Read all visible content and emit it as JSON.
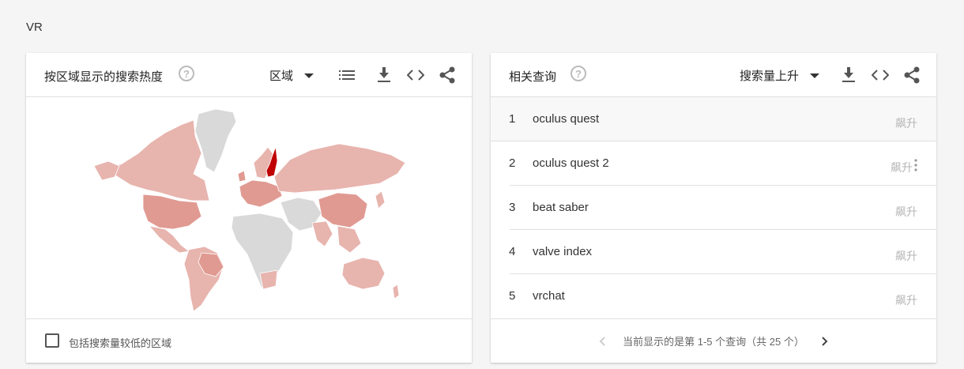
{
  "page": {
    "term": "VR"
  },
  "region_card": {
    "title": "按区域显示的搜索热度",
    "dropdown_label": "区域",
    "footer_checkbox_label": "包括搜索量较低的区域"
  },
  "related_card": {
    "title": "相关查询",
    "dropdown_label": "搜索量上升",
    "rows": [
      {
        "rank": "1",
        "query": "oculus quest",
        "value": "飙升"
      },
      {
        "rank": "2",
        "query": "oculus quest 2",
        "value": "飙升"
      },
      {
        "rank": "3",
        "query": "beat saber",
        "value": "飙升"
      },
      {
        "rank": "4",
        "query": "valve index",
        "value": "飙升"
      },
      {
        "rank": "5",
        "query": "vrchat",
        "value": "飙升"
      }
    ],
    "pager_text": "当前显示的是第 1-5 个查询（共 25 个）"
  },
  "icons": {
    "help": "help-circle-icon",
    "list": "list-icon",
    "download": "download-icon",
    "embed": "embed-code-icon",
    "share": "share-icon",
    "prev": "chevron-left-icon",
    "next": "chevron-right-icon"
  },
  "colors": {
    "map_low": "#e8b4ae",
    "map_mid": "#e09a92",
    "map_high": "#c00000",
    "map_none": "#d9d9d9"
  }
}
